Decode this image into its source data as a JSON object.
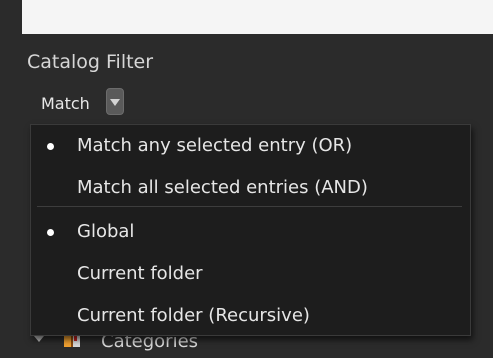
{
  "panel": {
    "title": "Catalog Filter",
    "match_label": "Match"
  },
  "menu": {
    "items": [
      {
        "label": "Match any selected entry (OR)",
        "selected": true
      },
      {
        "label": "Match all selected entries (AND)",
        "selected": false
      },
      {
        "label": "Global",
        "selected": true
      },
      {
        "label": "Current folder",
        "selected": false
      },
      {
        "label": "Current folder (Recursive)",
        "selected": false
      }
    ]
  },
  "tree": {
    "label": "Categories",
    "expanded": true
  },
  "icons": {
    "dropdown": "chevron-down-icon",
    "bullet": "bullet-icon",
    "tree_toggle": "triangle-down-icon",
    "categories": "book-icon"
  },
  "colors": {
    "background": "#2b2b2b",
    "menu_background": "#1d1d1d",
    "text": "#e6e6e6"
  }
}
